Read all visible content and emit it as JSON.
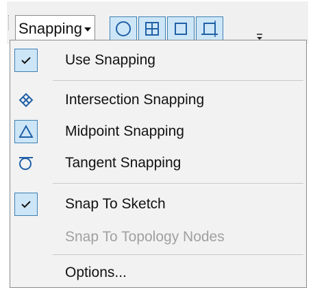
{
  "toolbar": {
    "dropdown_label": "Snapping",
    "buttons": [
      {
        "name": "point-snapping-button",
        "icon": "circle-icon"
      },
      {
        "name": "end-snapping-button",
        "icon": "grid-square-icon"
      },
      {
        "name": "vertex-snapping-button",
        "icon": "square-icon"
      },
      {
        "name": "edge-snapping-button",
        "icon": "edge-square-icon"
      }
    ],
    "overflow_icon": "toolbar-options-icon"
  },
  "menu": {
    "items": [
      {
        "label": "Use Snapping",
        "icon": "checkmark-icon",
        "checked": true,
        "enabled": true
      },
      {
        "label": "Intersection Snapping",
        "icon": "intersection-diamond-icon",
        "checked": false,
        "enabled": true
      },
      {
        "label": "Midpoint Snapping",
        "icon": "triangle-icon",
        "checked": true,
        "enabled": true
      },
      {
        "label": "Tangent Snapping",
        "icon": "tangent-sigma-icon",
        "checked": false,
        "enabled": true
      },
      {
        "label": "Snap To Sketch",
        "icon": "checkmark-icon",
        "checked": true,
        "enabled": true
      },
      {
        "label": "Snap To Topology Nodes",
        "icon": "",
        "checked": false,
        "enabled": false
      },
      {
        "label": "Options...",
        "icon": "",
        "checked": false,
        "enabled": true
      }
    ]
  },
  "colors": {
    "checked_bg": "#cde6f7",
    "checked_border": "#3c7fb1",
    "icon_blue": "#1f5fa6",
    "disabled_text": "#a0a0a0",
    "menu_bg": "#f2f2f2"
  }
}
